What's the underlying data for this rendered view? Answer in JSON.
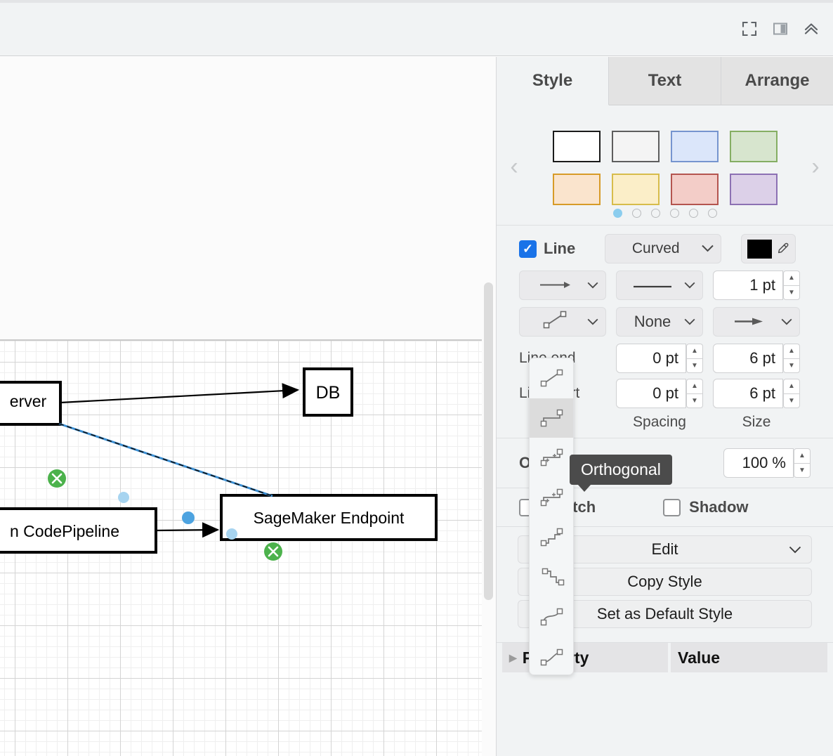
{
  "toolbar": {
    "icons": [
      {
        "name": "fullscreen-icon",
        "label": "Fullscreen"
      },
      {
        "name": "toggle-panel-icon",
        "label": "Format Panel"
      },
      {
        "name": "collapse-toolbar-icon",
        "label": "Collapse"
      }
    ]
  },
  "panel": {
    "tabs": [
      {
        "label": "Style",
        "active": true
      },
      {
        "label": "Text",
        "active": false
      },
      {
        "label": "Arrange",
        "active": false
      }
    ],
    "presets": {
      "prev_label": "‹",
      "next_label": "›",
      "swatches": [
        {
          "fill": "#ffffff",
          "stroke": "#1b1b1b"
        },
        {
          "fill": "#f4f4f4",
          "stroke": "#5e5e5e"
        },
        {
          "fill": "#dbe6fa",
          "stroke": "#7695cf"
        },
        {
          "fill": "#d7e5ce",
          "stroke": "#85ae63"
        },
        {
          "fill": "#fae4cd",
          "stroke": "#d79b28"
        },
        {
          "fill": "#fbeec8",
          "stroke": "#d7bc4b"
        },
        {
          "fill": "#f3cdc8",
          "stroke": "#b4554f"
        },
        {
          "fill": "#dcd0e8",
          "stroke": "#8c71b3"
        }
      ],
      "page_count": 6,
      "active_page": 1
    },
    "line": {
      "enabled": true,
      "label": "Line",
      "style_value": "Curved",
      "color": "#000000",
      "color_picker_icon": "eyedropper-icon",
      "arrow_style_icon": "arrow-right-icon",
      "dash_style_icon": "solid-line-icon",
      "width_value": "1 pt",
      "waypoint_icon": "straight-line-icon",
      "line_start_value": "None",
      "line_end_icon": "arrow-filled-icon",
      "line_end_label": "Line end",
      "line_start_label": "Line start",
      "line_end_spacing": "0 pt",
      "line_end_size": "6 pt",
      "line_start_spacing": "0 pt",
      "line_start_size": "6 pt",
      "spacing_caption": "Spacing",
      "size_caption": "Size"
    },
    "opacity": {
      "label": "Opacity",
      "value": "100 %"
    },
    "toggles": [
      {
        "label": "Sketch",
        "checked": false,
        "name": "sketch-checkbox"
      },
      {
        "label": "Shadow",
        "checked": false,
        "name": "shadow-checkbox"
      }
    ],
    "buttons": [
      {
        "label": "Edit",
        "has_chevron": true,
        "name": "edit-button"
      },
      {
        "label": "Copy Style",
        "has_chevron": false,
        "name": "copy-style-button"
      },
      {
        "label": "Set as Default Style",
        "has_chevron": false,
        "name": "set-default-style-button"
      }
    ],
    "property_table": {
      "property_header": "Property",
      "value_header": "Value"
    }
  },
  "line_style_dropdown": {
    "tooltip": "Orthogonal",
    "selected_index": 1,
    "items": [
      {
        "name": "straight-line-style",
        "label": "Straight"
      },
      {
        "name": "orthogonal-line-style",
        "label": "Orthogonal"
      },
      {
        "name": "simple-arc-line-style",
        "label": "Simple Arc"
      },
      {
        "name": "single-arc-line-style",
        "label": "Single Arc"
      },
      {
        "name": "entity-relation-line-style",
        "label": "Entity Relation"
      },
      {
        "name": "horizontal-line-style",
        "label": "Horizontal"
      },
      {
        "name": "vertical-line-style",
        "label": "Vertical"
      },
      {
        "name": "curved-line-style",
        "label": "Curved"
      }
    ]
  },
  "canvas": {
    "shapes": [
      {
        "name": "server-node",
        "label": "erver"
      },
      {
        "name": "db-node",
        "label": "DB"
      },
      {
        "name": "codepipeline-node",
        "label": "n CodePipeline"
      },
      {
        "name": "sagemaker-endpoint-node",
        "label": "SageMaker Endpoint"
      }
    ],
    "selected_edge": {
      "name": "selected-edge",
      "endpoint_marker": "✕",
      "endpoint_color": "#4ab04a",
      "line_color": "#3a8fd4",
      "waypoint_color": "#3a8fd4"
    }
  }
}
